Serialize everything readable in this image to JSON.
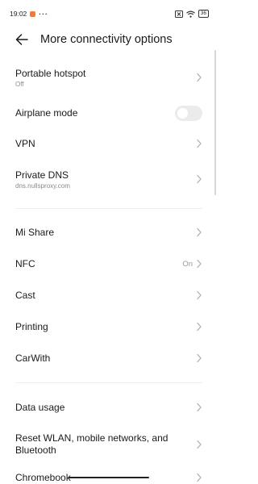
{
  "status_bar": {
    "time": "19:02",
    "dots": "···",
    "battery": "36"
  },
  "header": {
    "title": "More connectivity options"
  },
  "items": [
    {
      "label": "Portable hotspot",
      "sub": "Off"
    },
    {
      "label": "Airplane mode",
      "toggle_on": false
    },
    {
      "label": "VPN"
    },
    {
      "label": "Private DNS",
      "sub": "dns.nullsproxy.com"
    },
    {
      "label": "Mi Share"
    },
    {
      "label": "NFC",
      "value": "On"
    },
    {
      "label": "Cast"
    },
    {
      "label": "Printing"
    },
    {
      "label": "CarWith"
    },
    {
      "label": "Data usage"
    },
    {
      "label": "Reset WLAN, mobile networks, and Bluetooth"
    },
    {
      "label": "Chromebook"
    }
  ],
  "colors": {
    "accent_notification": "#f27b3a",
    "toggle_off": "#ebebeb",
    "secondary_text": "#8a8a8a"
  },
  "icons": {
    "back": "arrow-left-icon",
    "chevron": "chevron-right-icon",
    "wifi": "wifi-icon",
    "battery": "battery-icon",
    "sim": "sim-x-icon"
  }
}
